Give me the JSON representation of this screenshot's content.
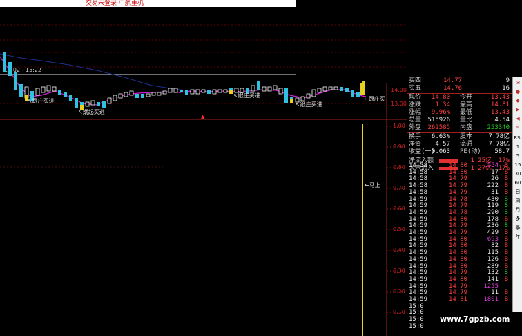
{
  "top_bar": {
    "text": "交易未登录    中航重机"
  },
  "chart": {
    "time_range": "15:02 - 15:22",
    "annotations": [
      "跟庄买进",
      "潮起买进",
      "跟庄买进",
      "跟庄买进",
      "跟庄买"
    ],
    "price_axis": [
      "14.00",
      "13.00"
    ],
    "indicator_axis": [
      "1.00",
      "0.90",
      "0.80",
      "0.70",
      "0.60",
      "0.50",
      "0.40",
      "0.30",
      "0.20",
      "0.10"
    ],
    "indicator_label": "马上"
  },
  "quote": {
    "order_book": [
      {
        "label": "买四",
        "price": "14.77",
        "vol": "9"
      },
      {
        "label": "买五",
        "price": "14.76",
        "vol": "16"
      }
    ],
    "stats": [
      {
        "l1": "现价",
        "v1": "14.80",
        "l2": "今开",
        "v2": "13.43"
      },
      {
        "l1": "涨跌",
        "v1": "1.34",
        "l2": "最高",
        "v2": "14.81"
      },
      {
        "l1": "涨幅",
        "v1": "9.96%",
        "l2": "最低",
        "v2": "13.43"
      },
      {
        "l1": "总量",
        "v1": "515926",
        "l2": "量比",
        "v2": "4.54"
      },
      {
        "l1": "外盘",
        "v1": "262585",
        "l2": "内盘",
        "v2": "253340"
      }
    ],
    "fundamentals": [
      {
        "l1": "换手",
        "v1": "6.63%",
        "l2": "股本",
        "v2": "7.78亿"
      },
      {
        "l1": "净资",
        "v1": "4.57",
        "l2": "流通",
        "v2": "7.78亿"
      },
      {
        "l1": "收益(一)",
        "v1": "0.063",
        "l2": "PE(动)",
        "v2": "58.7"
      }
    ],
    "flows": [
      {
        "label": "净流入额",
        "value": "1.25亿",
        "pct": "17%"
      },
      {
        "label": "大宗流入",
        "value": "1.27亿",
        "pct": "17%"
      }
    ],
    "ticks": [
      {
        "t": "14:58",
        "p": "14.80",
        "v": "554",
        "d": "B"
      },
      {
        "t": "14:58",
        "p": "14.80",
        "v": "17",
        "d": "B"
      },
      {
        "t": "14:58",
        "p": "14.79",
        "v": "26",
        "d": "B"
      },
      {
        "t": "14:58",
        "p": "14.79",
        "v": "222",
        "d": "B"
      },
      {
        "t": "14:58",
        "p": "14.79",
        "v": "31",
        "d": "B"
      },
      {
        "t": "14:59",
        "p": "14.78",
        "v": "430",
        "d": "S"
      },
      {
        "t": "14:59",
        "p": "14.79",
        "v": "119",
        "d": "S"
      },
      {
        "t": "14:59",
        "p": "14.78",
        "v": "290",
        "d": "S"
      },
      {
        "t": "14:59",
        "p": "14.80",
        "v": "178",
        "d": "B"
      },
      {
        "t": "14:59",
        "p": "14.79",
        "v": "236",
        "d": "S"
      },
      {
        "t": "14:59",
        "p": "14.79",
        "v": "429",
        "d": "B"
      },
      {
        "t": "14:59",
        "p": "14.80",
        "v": "693",
        "d": "B"
      },
      {
        "t": "14:59",
        "p": "14.80",
        "v": "82",
        "d": "B"
      },
      {
        "t": "14:59",
        "p": "14.80",
        "v": "115",
        "d": "B"
      },
      {
        "t": "14:59",
        "p": "14.80",
        "v": "126",
        "d": "B"
      },
      {
        "t": "14:59",
        "p": "14.80",
        "v": "289",
        "d": "B"
      },
      {
        "t": "14:59",
        "p": "14.79",
        "v": "132",
        "d": "S"
      },
      {
        "t": "14:59",
        "p": "14.80",
        "v": "141",
        "d": "B"
      },
      {
        "t": "14:59",
        "p": "14.79",
        "v": "1255",
        "d": ""
      },
      {
        "t": "14:59",
        "p": "14.79",
        "v": "11",
        "d": "B"
      },
      {
        "t": "14:59",
        "p": "14.81",
        "v": "1801",
        "d": "B"
      },
      {
        "t": "15:0",
        "p": "",
        "v": "",
        "d": ""
      },
      {
        "t": "15:0",
        "p": "",
        "v": "",
        "d": ""
      },
      {
        "t": "15:0",
        "p": "",
        "v": "",
        "d": ""
      },
      {
        "t": "15:0",
        "p": "",
        "v": "",
        "d": ""
      }
    ]
  },
  "toolbar": {
    "items": [
      "RSI",
      "1",
      "5",
      "15",
      "30",
      "60",
      "日",
      "周",
      "月",
      "多",
      "季",
      "年"
    ]
  },
  "watermark": "www.7gpzb.com",
  "colors": {
    "up": "#ff4040",
    "down": "#20d020",
    "neutral": "#e8e8e8",
    "big": "#d040d0",
    "candle_up": "#ffffff",
    "candle_down": "#30c0e0",
    "ma": "#d020d0"
  }
}
